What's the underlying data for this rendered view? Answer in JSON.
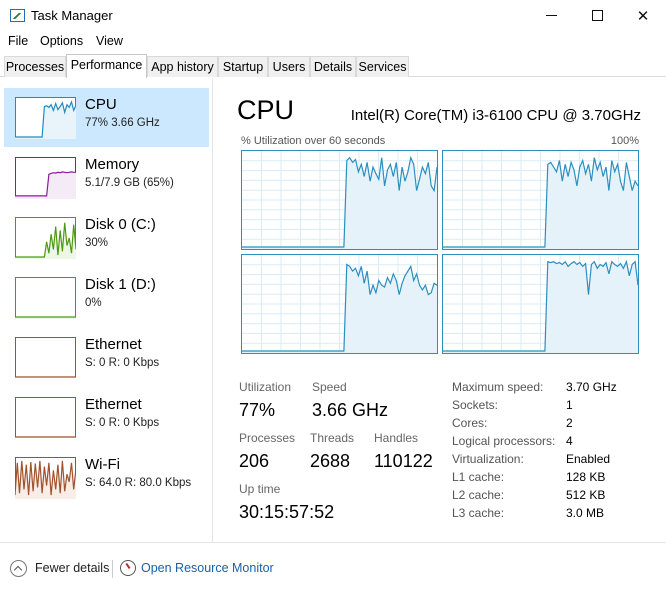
{
  "window": {
    "title": "Task Manager"
  },
  "menu": [
    "File",
    "Options",
    "View"
  ],
  "tabs": [
    {
      "label": "Processes",
      "active": false
    },
    {
      "label": "Performance",
      "active": true
    },
    {
      "label": "App history",
      "active": false
    },
    {
      "label": "Startup",
      "active": false
    },
    {
      "label": "Users",
      "active": false
    },
    {
      "label": "Details",
      "active": false
    },
    {
      "label": "Services",
      "active": false
    }
  ],
  "sidebar": [
    {
      "title": "CPU",
      "sub": "77% 3.66 GHz",
      "color": "#1f8dc4",
      "fill": "#e8f3fa",
      "selected": true,
      "series": [
        0,
        0,
        0,
        0,
        0,
        0,
        0,
        0,
        0,
        0,
        0,
        0,
        0,
        80,
        82,
        78,
        85,
        70,
        88,
        72,
        80,
        90,
        65,
        85,
        78,
        92,
        70,
        84
      ]
    },
    {
      "title": "Memory",
      "sub": "5.1/7.9 GB (65%)",
      "color": "#8b1a9e",
      "fill": "#f5ebf7",
      "selected": false,
      "series": [
        3,
        3,
        3,
        3,
        3,
        3,
        3,
        3,
        3,
        3,
        3,
        3,
        3,
        3,
        3,
        60,
        62,
        64,
        63,
        65,
        64,
        66,
        65,
        64,
        65,
        66,
        65,
        65
      ]
    },
    {
      "title": "Disk 0 (C:)",
      "sub": "30%",
      "color": "#4c9a12",
      "fill": "#eef6e5",
      "selected": false,
      "series": [
        0,
        0,
        0,
        0,
        0,
        0,
        0,
        0,
        0,
        0,
        0,
        0,
        0,
        0,
        40,
        10,
        60,
        20,
        80,
        5,
        70,
        15,
        90,
        30,
        50,
        10,
        85,
        20
      ]
    },
    {
      "title": "Disk 1 (D:)",
      "sub": "0%",
      "color": "#4c9a12",
      "fill": "#eef6e5",
      "selected": false,
      "series": [
        0,
        0,
        0,
        0,
        0,
        0,
        0,
        0,
        0,
        0,
        0,
        0,
        0,
        0,
        0,
        0,
        0,
        0,
        0,
        0,
        0,
        0,
        0,
        0,
        0,
        0,
        0,
        0
      ]
    },
    {
      "title": "Ethernet",
      "sub_prefix": "S: 0 R: 0 Kbps",
      "sub": "S: 0 R: 0 Kbps",
      "color": "#a0522d",
      "fill": "#fff",
      "selected": false,
      "series": [
        0,
        0,
        0,
        0,
        0,
        0,
        0,
        0,
        0,
        0,
        0,
        0,
        0,
        0,
        0,
        0,
        0,
        0,
        0,
        0,
        0,
        0,
        0,
        0,
        0,
        0,
        0,
        0
      ]
    },
    {
      "title": "Ethernet",
      "sub": "S: 0 R: 0 Kbps",
      "color": "#a0522d",
      "fill": "#fff",
      "selected": false,
      "series": [
        0,
        0,
        0,
        0,
        0,
        0,
        0,
        0,
        0,
        0,
        0,
        0,
        0,
        0,
        0,
        0,
        0,
        0,
        0,
        0,
        0,
        0,
        0,
        0,
        0,
        0,
        0,
        0
      ]
    },
    {
      "title": "Wi-Fi",
      "sub": "S: 64.0 R: 80.0 Kbps",
      "color": "#a0522d",
      "fill": "#f8eee7",
      "selected": false,
      "series": [
        5,
        90,
        10,
        95,
        20,
        85,
        5,
        92,
        15,
        88,
        25,
        95,
        10,
        80,
        30,
        90,
        5,
        70,
        20,
        85,
        10,
        95,
        15,
        60,
        40,
        90,
        20,
        75
      ]
    }
  ],
  "main": {
    "title": "CPU",
    "model": "Intel(R) Core(TM) i3-6100 CPU @ 3.70GHz",
    "caption_left": "% Utilization over 60 seconds",
    "caption_right": "100%",
    "graph_color": "#2b8fbf",
    "graph_fill": "#e6f2f9",
    "cores": [
      [
        0,
        0,
        0,
        0,
        0,
        0,
        0,
        0,
        0,
        0,
        0,
        0,
        0,
        0,
        0,
        0,
        0,
        0,
        0,
        0,
        0,
        0,
        0,
        0,
        0,
        0,
        0,
        0,
        0,
        0,
        0,
        0,
        0,
        0,
        0,
        0,
        92,
        95,
        90,
        93,
        80,
        88,
        75,
        90,
        70,
        85,
        78,
        72,
        95,
        65,
        82,
        88,
        75,
        90,
        60,
        85,
        70,
        80,
        95,
        88,
        60,
        72,
        85,
        78,
        90,
        65,
        60,
        85
      ],
      [
        0,
        0,
        0,
        0,
        0,
        0,
        0,
        0,
        0,
        0,
        0,
        0,
        0,
        0,
        0,
        0,
        0,
        0,
        0,
        0,
        0,
        0,
        0,
        0,
        0,
        0,
        0,
        0,
        0,
        0,
        0,
        0,
        0,
        0,
        0,
        0,
        88,
        90,
        85,
        80,
        92,
        70,
        88,
        75,
        90,
        82,
        65,
        85,
        92,
        78,
        88,
        70,
        95,
        82,
        90,
        75,
        85,
        60,
        92,
        80,
        88,
        70,
        60,
        90,
        75,
        60,
        70,
        65
      ],
      [
        0,
        0,
        0,
        0,
        0,
        0,
        0,
        0,
        0,
        0,
        0,
        0,
        0,
        0,
        0,
        0,
        0,
        0,
        0,
        0,
        0,
        0,
        0,
        0,
        0,
        0,
        0,
        0,
        0,
        0,
        0,
        0,
        0,
        0,
        0,
        0,
        92,
        90,
        85,
        88,
        80,
        90,
        72,
        85,
        60,
        70,
        62,
        75,
        70,
        68,
        78,
        72,
        82,
        75,
        60,
        72,
        80,
        85,
        90,
        75,
        82,
        70,
        65,
        70,
        60,
        62,
        72,
        70
      ],
      [
        0,
        0,
        0,
        0,
        0,
        0,
        0,
        0,
        0,
        0,
        0,
        0,
        0,
        0,
        0,
        0,
        0,
        0,
        0,
        0,
        0,
        0,
        0,
        0,
        0,
        0,
        0,
        0,
        0,
        0,
        0,
        0,
        0,
        0,
        0,
        0,
        95,
        94,
        95,
        93,
        94,
        92,
        95,
        90,
        93,
        95,
        92,
        94,
        90,
        93,
        60,
        92,
        95,
        88,
        92,
        90,
        94,
        82,
        95,
        92,
        90,
        93,
        88,
        95,
        80,
        92,
        95,
        70
      ]
    ],
    "stats": {
      "utilization_label": "Utilization",
      "utilization_value": "77%",
      "speed_label": "Speed",
      "speed_value": "3.66 GHz",
      "processes_label": "Processes",
      "processes_value": "206",
      "threads_label": "Threads",
      "threads_value": "2688",
      "handles_label": "Handles",
      "handles_value": "110122",
      "uptime_label": "Up time",
      "uptime_value": "30:15:57:52"
    },
    "specs": [
      {
        "label": "Maximum speed:",
        "value": "3.70 GHz"
      },
      {
        "label": "Sockets:",
        "value": "1"
      },
      {
        "label": "Cores:",
        "value": "2"
      },
      {
        "label": "Logical processors:",
        "value": "4"
      },
      {
        "label": "Virtualization:",
        "value": "Enabled"
      },
      {
        "label": "L1 cache:",
        "value": "128 KB"
      },
      {
        "label": "L2 cache:",
        "value": "512 KB"
      },
      {
        "label": "L3 cache:",
        "value": "3.0 MB"
      }
    ]
  },
  "footer": {
    "fewer_details": "Fewer details",
    "open_monitor": "Open Resource Monitor"
  }
}
